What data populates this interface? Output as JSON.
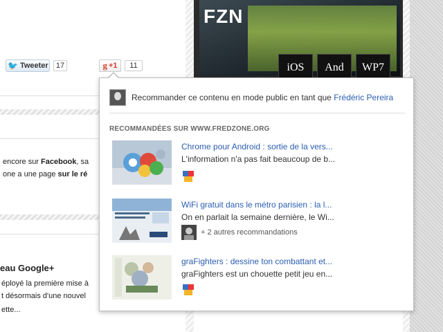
{
  "photo": {
    "logo": "FZN",
    "tags": [
      "iOS",
      "And",
      "WP7"
    ]
  },
  "share_bar": {
    "tweet_label": "Tweeter",
    "tweet_count": "17",
    "gplus_g": "g",
    "gplus_label": "+1",
    "gplus_count": "11"
  },
  "article": {
    "line1_prefix": "encore sur ",
    "line1_bold": "Facebook",
    "line1_suffix": ", sa",
    "line2_prefix": "one a une page ",
    "line2_bold": "sur le ré",
    "heading": "eau Google+",
    "line3": "éployé la première mise à",
    "line4": "t désormais d'une nouvel",
    "line5": "ette..."
  },
  "popup": {
    "recommend_text": "Recommander ce contenu en mode public en tant que ",
    "recommend_user": "Frédéric Pereira",
    "section_title": "RECOMMANDÉES SUR WWW.FREDZONE.ORG",
    "items": [
      {
        "title": "Chrome pour Android : sortie de la vers...",
        "desc": "L'information n'a pas fait beaucoup de b...",
        "others": ""
      },
      {
        "title": "WiFi gratuit dans le métro parisien : la l...",
        "desc": "On en parlait la semaine dernière, le Wi...",
        "others": "+ 2 autres recommandations"
      },
      {
        "title": "graFighters : dessine ton combattant et...",
        "desc": "graFighters est un chouette petit jeu en...",
        "others": ""
      }
    ]
  }
}
